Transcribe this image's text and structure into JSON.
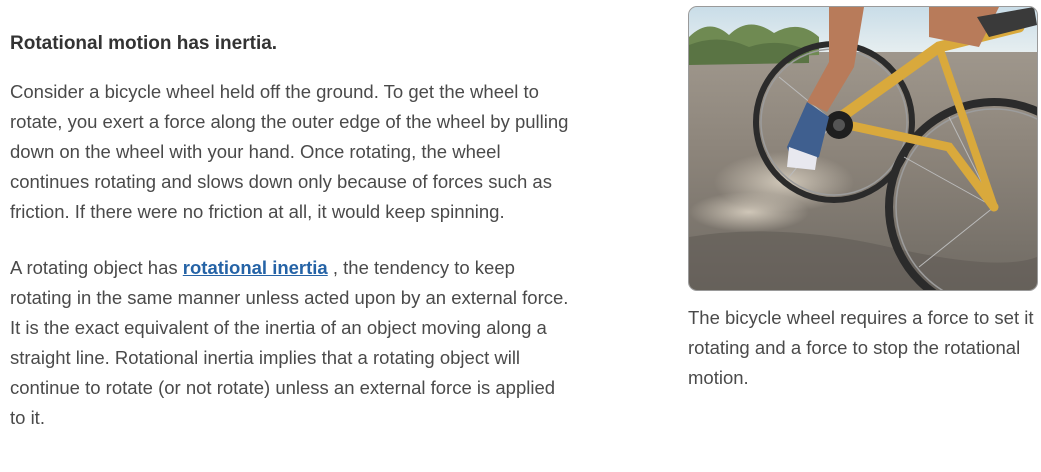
{
  "article": {
    "heading": "Rotational motion has inertia.",
    "paragraph1": "Consider a bicycle wheel held off the ground. To get the wheel to rotate, you exert a force along the outer edge of the wheel by pulling down on the wheel with your hand. Once rotating, the wheel continues rotating and slows down only because of forces such as friction. If there were no friction at all, it would keep spinning.",
    "paragraph2": {
      "before": "A rotating object has ",
      "link": "rotational inertia",
      "after": " , the tendency to keep rotating in the same manner unless acted upon by an external force. It is the exact equivalent of the inertia of an object moving along a straight line. Rotational inertia implies that a rotating object will continue to rotate (or not rotate) unless an external force is applied to it."
    }
  },
  "figure": {
    "caption": "The bicycle wheel requires a force to set it rotating and a force to stop the rotational motion."
  },
  "colors": {
    "link": "#2563a6",
    "body_text": "#4a4a4a",
    "heading": "#333333"
  }
}
